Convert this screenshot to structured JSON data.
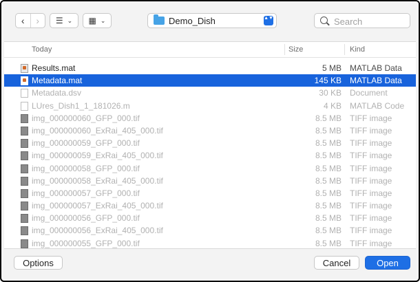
{
  "toolbar": {
    "back_glyph": "‹",
    "forward_glyph": "›",
    "list_view_glyph": "☰",
    "grid_view_glyph": "▦",
    "chevron_glyph": "⌄",
    "location": "Demo_Dish",
    "updown_glyph": "▲▼",
    "search_placeholder": "Search"
  },
  "columns": {
    "name": "Today",
    "size": "Size",
    "kind": "Kind"
  },
  "files": [
    {
      "name": "Results.mat",
      "size": "5 MB",
      "kind": "MATLAB Data",
      "icon": "mat-file-icon",
      "state": "enabled"
    },
    {
      "name": "Metadata.mat",
      "size": "145 KB",
      "kind": "MATLAB Data",
      "icon": "mat-file-icon",
      "state": "selected"
    },
    {
      "name": "Metadata.dsv",
      "size": "30 KB",
      "kind": "Document",
      "icon": "document-icon",
      "state": "disabled"
    },
    {
      "name": "LUres_Dish1_1_181026.m",
      "size": "4 KB",
      "kind": "MATLAB Code",
      "icon": "document-icon",
      "state": "disabled"
    },
    {
      "name": "img_000000060_GFP_000.tif",
      "size": "8.5 MB",
      "kind": "TIFF image",
      "icon": "tiff-image-icon",
      "state": "disabled"
    },
    {
      "name": "img_000000060_ExRai_405_000.tif",
      "size": "8.5 MB",
      "kind": "TIFF image",
      "icon": "tiff-image-icon",
      "state": "disabled"
    },
    {
      "name": "img_000000059_GFP_000.tif",
      "size": "8.5 MB",
      "kind": "TIFF image",
      "icon": "tiff-image-icon",
      "state": "disabled"
    },
    {
      "name": "img_000000059_ExRai_405_000.tif",
      "size": "8.5 MB",
      "kind": "TIFF image",
      "icon": "tiff-image-icon",
      "state": "disabled"
    },
    {
      "name": "img_000000058_GFP_000.tif",
      "size": "8.5 MB",
      "kind": "TIFF image",
      "icon": "tiff-image-icon",
      "state": "disabled"
    },
    {
      "name": "img_000000058_ExRai_405_000.tif",
      "size": "8.5 MB",
      "kind": "TIFF image",
      "icon": "tiff-image-icon",
      "state": "disabled"
    },
    {
      "name": "img_000000057_GFP_000.tif",
      "size": "8.5 MB",
      "kind": "TIFF image",
      "icon": "tiff-image-icon",
      "state": "disabled"
    },
    {
      "name": "img_000000057_ExRai_405_000.tif",
      "size": "8.5 MB",
      "kind": "TIFF image",
      "icon": "tiff-image-icon",
      "state": "disabled"
    },
    {
      "name": "img_000000056_GFP_000.tif",
      "size": "8.5 MB",
      "kind": "TIFF image",
      "icon": "tiff-image-icon",
      "state": "disabled"
    },
    {
      "name": "img_000000056_ExRai_405_000.tif",
      "size": "8.5 MB",
      "kind": "TIFF image",
      "icon": "tiff-image-icon",
      "state": "disabled"
    },
    {
      "name": "img_000000055_GFP_000.tif",
      "size": "8.5 MB",
      "kind": "TIFF image",
      "icon": "tiff-image-icon",
      "state": "disabled"
    }
  ],
  "buttons": {
    "options": "Options",
    "cancel": "Cancel",
    "open": "Open"
  },
  "colors": {
    "accent": "#1e6fe5",
    "selection": "#1863dc",
    "folder": "#46a3e6"
  }
}
